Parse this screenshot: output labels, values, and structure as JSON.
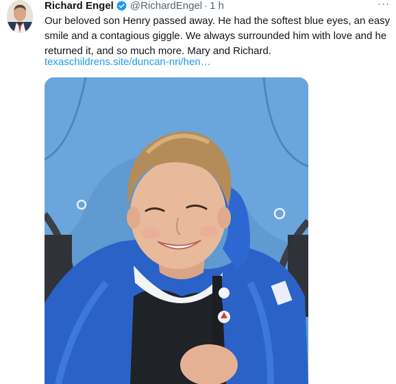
{
  "tweet": {
    "display_name": "Richard Engel",
    "verified": true,
    "handle": "@RichardEngel",
    "separator": "·",
    "time": "1 h",
    "more_label": "···",
    "text": "Our beloved son Henry passed away.  He had the softest blue eyes, an easy\nsmile and a contagious giggle.  We always surrounded him with love and he\nreturned it, and so much more.  Mary and Richard.",
    "link_text": "texaschildrens.site/duncan-nri/hen…",
    "icons": {
      "verified": "verified-badge-icon",
      "more": "more-options-icon"
    },
    "colors": {
      "text": "#0f1419",
      "secondary": "#536471",
      "link": "#1d9bf0",
      "verified": "#1d9bf0"
    }
  }
}
